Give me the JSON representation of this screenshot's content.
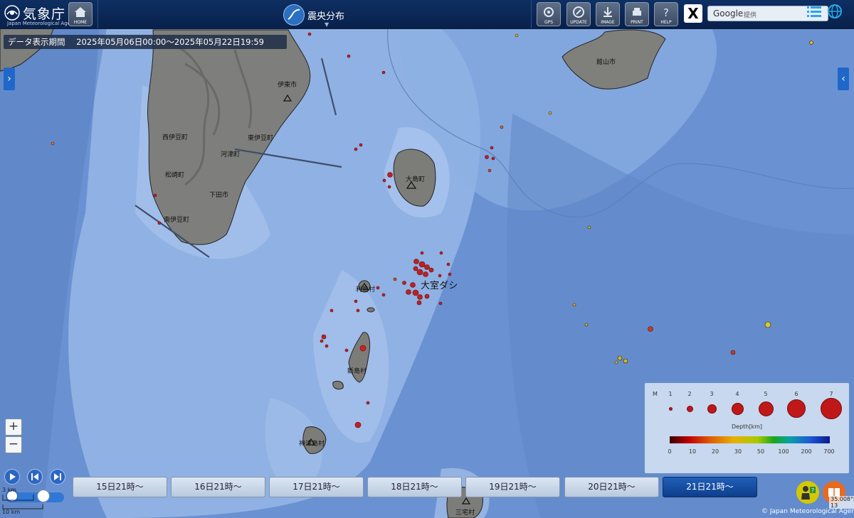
{
  "header": {
    "logo_title": "気象庁",
    "logo_sub": "Japan Meteorological Agency",
    "page_title": "震央分布",
    "buttons": [
      {
        "id": "home",
        "label": "HOME",
        "icon": "home-icon"
      },
      {
        "id": "gps",
        "label": "GPS",
        "icon": "gps-icon"
      },
      {
        "id": "update",
        "label": "UPDATE",
        "icon": "update-icon"
      },
      {
        "id": "image",
        "label": "IMAGE",
        "icon": "download-icon"
      },
      {
        "id": "print",
        "label": "PRINT",
        "icon": "print-icon"
      },
      {
        "id": "help",
        "label": "HELP",
        "icon": "help-icon"
      }
    ],
    "x_label": "X",
    "google_label": "Google",
    "google_suffix": "提供"
  },
  "period": {
    "label": "データ表示期間",
    "value": "2025年05月06日00:00～2025年05月22日19:59"
  },
  "map": {
    "place_labels": [
      "伊東市",
      "東伊豆町",
      "河津町",
      "西伊豆町",
      "松崎町",
      "南伊豆町",
      "下田市",
      "大島町",
      "利島村",
      "新島村",
      "神津島村",
      "三宅村",
      "館山市"
    ],
    "feature_label": "大室ダシ"
  },
  "zoom": {
    "in": "+",
    "out": "−"
  },
  "timeline": {
    "days": [
      "15日21時～",
      "16日21時～",
      "17日21時～",
      "18日21時～",
      "19日21時～",
      "20日21時～",
      "21日21時～"
    ],
    "active_index": 6
  },
  "legend": {
    "m_label": "M",
    "magnitudes": [
      "1",
      "2",
      "3",
      "4",
      "5",
      "6",
      "7"
    ],
    "depth_label": "Depth[km]",
    "depth_ticks": [
      "0",
      "10",
      "20",
      "30",
      "50",
      "100",
      "200",
      "700"
    ]
  },
  "scale": {
    "top": "3 km",
    "bottom": "10 km"
  },
  "coord_text": "35.008°N 13",
  "copyright": "© Japan Meteorological Agency"
}
